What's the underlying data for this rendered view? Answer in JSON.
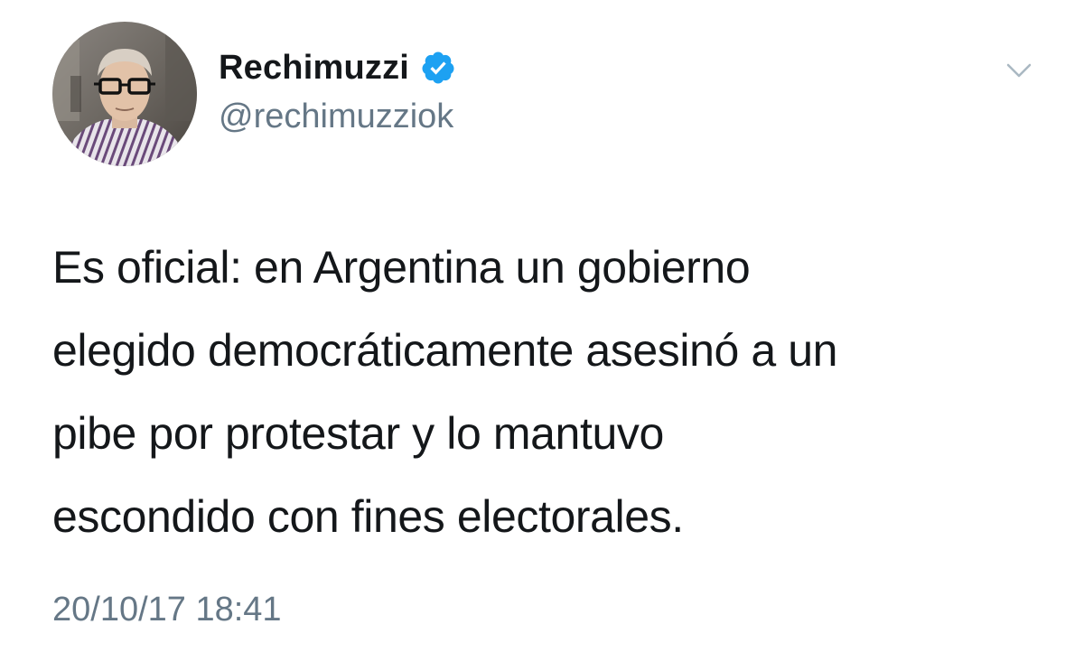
{
  "tweet": {
    "author": {
      "display_name": "Rechimuzzi",
      "handle": "@rechimuzziok",
      "verified": true,
      "avatar_icon": "profile-photo"
    },
    "menu_icon": "chevron-down-icon",
    "text": "Es oficial: en Argentina un gobierno\nelegido democráticamente asesinó a un\npibe por protestar y lo mantuvo\nescondido con fines electorales.",
    "timestamp": "20/10/17 18:41"
  },
  "colors": {
    "text_primary": "#14171a",
    "text_secondary": "#657786",
    "verified_blue": "#1da1f2",
    "chevron": "#aab8c2"
  }
}
